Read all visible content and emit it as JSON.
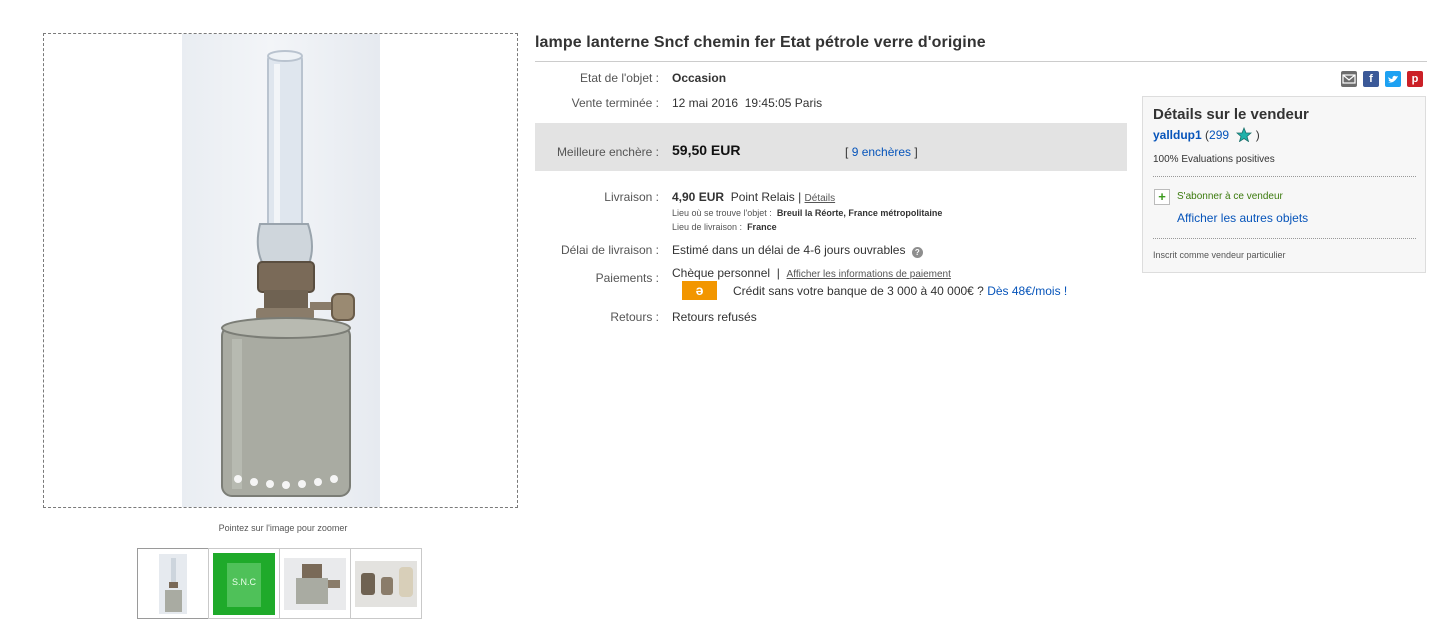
{
  "listing": {
    "title": "lampe lanterne Sncf chemin fer Etat pétrole verre d'origine",
    "zoom_hint": "Pointez sur l'image pour zoomer",
    "thumbnails": [
      "thumb-1",
      "thumb-2",
      "thumb-3",
      "thumb-4"
    ]
  },
  "details": {
    "condition_label": "Etat de l'objet :",
    "condition_value": "Occasion",
    "ended_label": "Vente terminée :",
    "ended_date": "12 mai 2016",
    "ended_time": "19:45:05 Paris",
    "bid_label": "Meilleure enchère :",
    "bid_value": "59,50 EUR",
    "bid_count_open": "[",
    "bid_count_link": "9 enchères",
    "bid_count_close": "]",
    "shipping_label": "Livraison :",
    "shipping_price": "4,90 EUR",
    "shipping_method": "Point Relais |",
    "shipping_details_link": "Détails",
    "item_location_label": "Lieu où se trouve l'objet :",
    "item_location_value": "Breuil la Réorte, France métropolitaine",
    "ships_to_label": "Lieu de livraison :",
    "ships_to_value": "France",
    "delivery_label": "Délai de livraison :",
    "delivery_value": "Estimé dans un délai de 4-6 jours ouvrables",
    "payments_label": "Paiements :",
    "payments_value": "Chèque personnel",
    "payments_separator": "|",
    "payments_info_link": "Afficher les informations de paiement",
    "credit_logo_text": "ə",
    "credit_text": "Crédit sans votre banque de 3 000 à 40 000€ ?",
    "credit_link": "Dès 48€/mois !",
    "returns_label": "Retours :",
    "returns_value": "Retours refusés"
  },
  "share_icons": [
    "email-icon",
    "facebook-icon",
    "twitter-icon",
    "pinterest-icon"
  ],
  "seller": {
    "title": "Détails sur le vendeur",
    "username": "yalldup1",
    "feedback_open": "(",
    "feedback_score": "299",
    "feedback_close": ")",
    "positive": "100% Evaluations positives",
    "follow": "S'abonner à ce vendeur",
    "other_items": "Afficher les autres objets",
    "note": "Inscrit comme vendeur particulier"
  },
  "colors": {
    "link": "#0654ba",
    "bid_band": "#e3e3e3",
    "credit_logo": "#f29600",
    "facebook": "#3b5998",
    "twitter": "#1da1f2",
    "pinterest": "#cb2027",
    "email": "#6d6d6d",
    "star": "#20b2aa"
  }
}
